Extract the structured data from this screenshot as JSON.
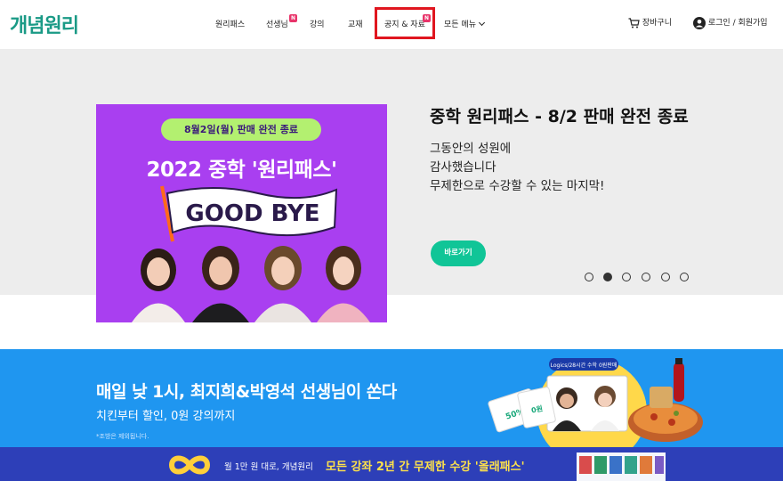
{
  "header": {
    "logo": "개념원리",
    "nav": [
      {
        "label": "원리패스"
      },
      {
        "label": "선생님",
        "badge": "N"
      },
      {
        "label": "강의"
      },
      {
        "label": "교재"
      },
      {
        "label": "공지 & 자료",
        "badge": "N"
      },
      {
        "label": "모든 메뉴"
      }
    ],
    "cart_label": "장바구니",
    "login_label": "로그인 / 회원가입"
  },
  "hero": {
    "banner": {
      "pill": "8월2일(월) 판매 완전 종료",
      "headline": "2022 중학 '원리패스'",
      "flag_text": "GOOD  BYE"
    },
    "title": "중학 원리패스 - 8/2 판매 완전 종료",
    "description": "그동안의 성원에\n감사했습니다\n무제한으로 수강할 수 있는 마지막!",
    "cta": "바로가기",
    "slide_count": 6,
    "active_slide": 2
  },
  "promo": {
    "title": "매일 낮 1시, 최지희&박영석 선생님이 쏜다",
    "subtitle": "치킨부터 할인, 0원 강의까지",
    "note": "*조방은 제외됩니다.",
    "art_label": "Logics/28시간 수학 0원판매",
    "coupon_1": "50%",
    "coupon_2": "0원"
  },
  "strip": {
    "text1": "월 1만 원 대로, 개념원리",
    "text2": "모든 강좌 2년 간 무제한 수강 '올래패스'"
  },
  "colors": {
    "brand": "#1a9a86",
    "highlight": "#e0161f",
    "badge": "#e8346a",
    "cta": "#10c597",
    "banner_bg": "#a93ff0",
    "promo_bg": "#1f96f0",
    "strip_bg": "#2d3fb8"
  },
  "icons": [
    "cart-icon",
    "user-circle-icon",
    "chevron-down-icon",
    "infinity-icon"
  ]
}
